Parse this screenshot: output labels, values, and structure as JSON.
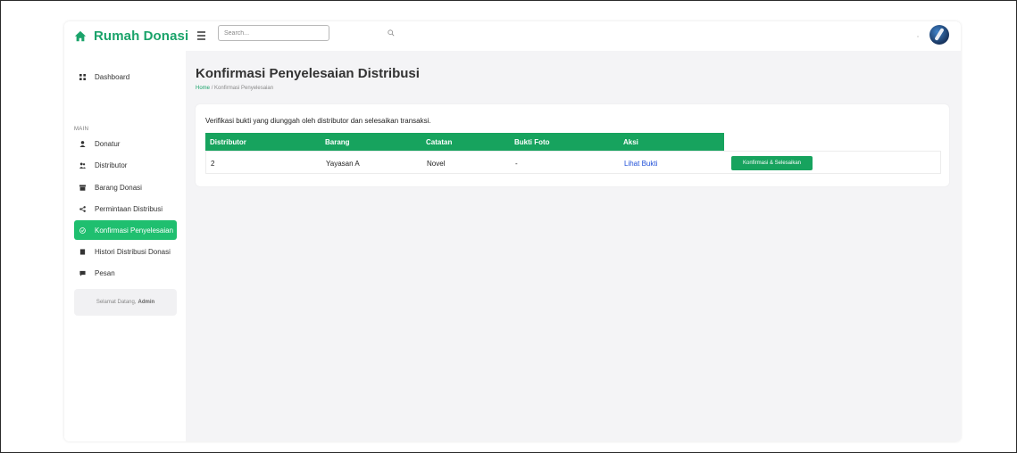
{
  "app": {
    "brand": "Rumah Donasi"
  },
  "topbar": {
    "search_placeholder": "Search..."
  },
  "sidebar": {
    "section_label": "MAIN",
    "items": [
      {
        "label": "Dashboard",
        "icon": "grid-icon"
      },
      {
        "label": "Donatur",
        "icon": "user-icon"
      },
      {
        "label": "Distributor",
        "icon": "users-icon"
      },
      {
        "label": "Barang Donasi",
        "icon": "box-icon"
      },
      {
        "label": "Permintaan Distribusi",
        "icon": "share-icon"
      },
      {
        "label": "Konfirmasi Penyelesaian",
        "icon": "check-circle-icon",
        "active": true
      },
      {
        "label": "Histori Distribusi Donasi",
        "icon": "book-icon"
      },
      {
        "label": "Pesan",
        "icon": "message-icon"
      }
    ],
    "welcome_text": "Selamat Datang,",
    "welcome_user": "Admin"
  },
  "main": {
    "title": "Konfirmasi Penyelesaian Distribusi",
    "breadcrumb_home": "Home",
    "breadcrumb_sep": "/",
    "breadcrumb_current": "Konfirmasi Penyelesaian",
    "description": "Verifikasi bukti yang diunggah oleh distributor dan selesaikan transaksi.",
    "table": {
      "headers": [
        "Distributor",
        "Barang",
        "Catatan",
        "Bukti Foto",
        "Aksi"
      ],
      "rows": [
        {
          "distributor": "2",
          "barang": "Yayasan A",
          "catatan": "Novel",
          "bukti_foto": "-",
          "aksi_link": "Lihat Bukti",
          "aksi_button": "Konfirmasi & Selesaikan"
        }
      ]
    }
  },
  "colors": {
    "brand": "#1aa36a",
    "active_nav": "#1fbf6f",
    "table_header": "#17a35e",
    "link": "#1f4fd8"
  }
}
